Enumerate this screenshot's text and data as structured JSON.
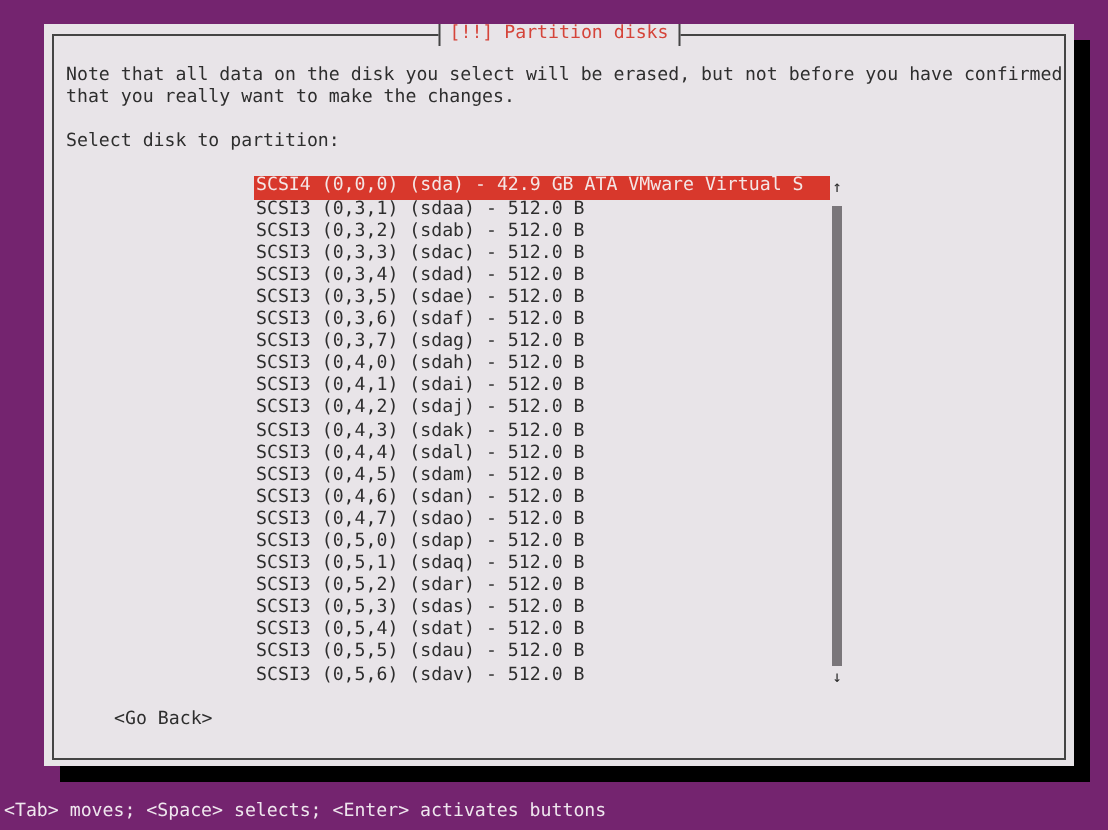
{
  "dialog": {
    "title": "[!!] Partition disks",
    "note": "Note that all data on the disk you select will be erased, but not before you have confirmed that you really want to make the changes.",
    "prompt": "Select disk to partition:",
    "disks": [
      {
        "label": "SCSI4 (0,0,0) (sda) - 42.9 GB ATA VMware Virtual S",
        "selected": true
      },
      {
        "label": "SCSI3 (0,3,1) (sdaa) - 512.0 B",
        "selected": false
      },
      {
        "label": "SCSI3 (0,3,2) (sdab) - 512.0 B",
        "selected": false
      },
      {
        "label": "SCSI3 (0,3,3) (sdac) - 512.0 B",
        "selected": false
      },
      {
        "label": "SCSI3 (0,3,4) (sdad) - 512.0 B",
        "selected": false
      },
      {
        "label": "SCSI3 (0,3,5) (sdae) - 512.0 B",
        "selected": false
      },
      {
        "label": "SCSI3 (0,3,6) (sdaf) - 512.0 B",
        "selected": false
      },
      {
        "label": "SCSI3 (0,3,7) (sdag) - 512.0 B",
        "selected": false
      },
      {
        "label": "SCSI3 (0,4,0) (sdah) - 512.0 B",
        "selected": false
      },
      {
        "label": "SCSI3 (0,4,1) (sdai) - 512.0 B",
        "selected": false
      },
      {
        "label": "SCSI3 (0,4,2) (sdaj) - 512.0 B",
        "selected": false
      },
      {
        "label": "SCSI3 (0,4,3) (sdak) - 512.0 B",
        "selected": false
      },
      {
        "label": "SCSI3 (0,4,4) (sdal) - 512.0 B",
        "selected": false
      },
      {
        "label": "SCSI3 (0,4,5) (sdam) - 512.0 B",
        "selected": false
      },
      {
        "label": "SCSI3 (0,4,6) (sdan) - 512.0 B",
        "selected": false
      },
      {
        "label": "SCSI3 (0,4,7) (sdao) - 512.0 B",
        "selected": false
      },
      {
        "label": "SCSI3 (0,5,0) (sdap) - 512.0 B",
        "selected": false
      },
      {
        "label": "SCSI3 (0,5,1) (sdaq) - 512.0 B",
        "selected": false
      },
      {
        "label": "SCSI3 (0,5,2) (sdar) - 512.0 B",
        "selected": false
      },
      {
        "label": "SCSI3 (0,5,3) (sdas) - 512.0 B",
        "selected": false
      },
      {
        "label": "SCSI3 (0,5,4) (sdat) - 512.0 B",
        "selected": false
      },
      {
        "label": "SCSI3 (0,5,5) (sdau) - 512.0 B",
        "selected": false
      },
      {
        "label": "SCSI3 (0,5,6) (sdav) - 512.0 B",
        "selected": false
      }
    ],
    "scroll_up": "↑",
    "scroll_down": "↓",
    "back_button": "<Go Back>"
  },
  "status_bar": "<Tab> moves; <Space> selects; <Enter> activates buttons"
}
